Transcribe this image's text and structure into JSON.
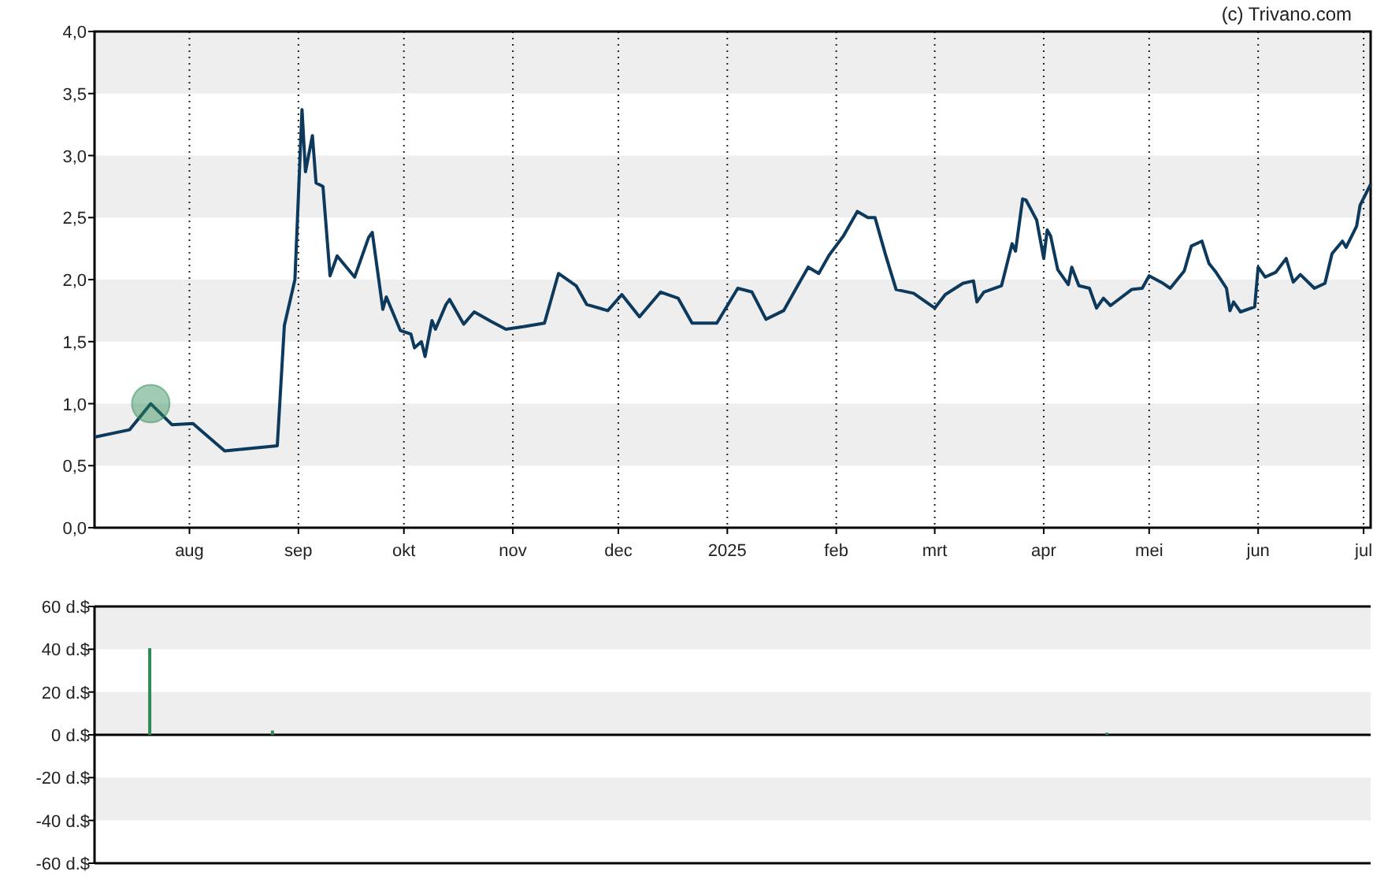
{
  "credit": "(c) Trivano.com",
  "price_chart": {
    "chart_data": {
      "type": "line",
      "xlim": [
        "2024-07-05",
        "2025-07-03"
      ],
      "ylim": [
        0,
        4
      ],
      "yticks": [
        {
          "value": 0,
          "label": "0,0"
        },
        {
          "value": 0.5,
          "label": "0,5"
        },
        {
          "value": 1,
          "label": "1,0"
        },
        {
          "value": 1.5,
          "label": "1,5"
        },
        {
          "value": 2,
          "label": "2,0"
        },
        {
          "value": 2.5,
          "label": "2,5"
        },
        {
          "value": 3,
          "label": "3,0"
        },
        {
          "value": 3.5,
          "label": "3,5"
        },
        {
          "value": 4,
          "label": "4,0"
        }
      ],
      "xticks": [
        {
          "value": "2024-08-01",
          "label": "aug"
        },
        {
          "value": "2024-09-01",
          "label": "sep"
        },
        {
          "value": "2024-10-01",
          "label": "okt"
        },
        {
          "value": "2024-11-01",
          "label": "nov"
        },
        {
          "value": "2024-12-01",
          "label": "dec"
        },
        {
          "value": "2025-01-01",
          "label": "2025"
        },
        {
          "value": "2025-02-01",
          "label": "feb"
        },
        {
          "value": "2025-03-01",
          "label": "mrt"
        },
        {
          "value": "2025-04-01",
          "label": "apr"
        },
        {
          "value": "2025-05-01",
          "label": "mei"
        },
        {
          "value": "2025-06-01",
          "label": "jun"
        },
        {
          "value": "2025-07-01",
          "label": "jul"
        }
      ],
      "x": [
        "2024-07-05",
        "2024-07-15",
        "2024-07-21",
        "2024-07-27",
        "2024-08-02",
        "2024-08-11",
        "2024-08-26",
        "2024-08-28",
        "2024-08-31",
        "2024-09-02",
        "2024-09-03",
        "2024-09-05",
        "2024-09-06",
        "2024-09-08",
        "2024-09-10",
        "2024-09-12",
        "2024-09-17",
        "2024-09-21",
        "2024-09-22",
        "2024-09-25",
        "2024-09-26",
        "2024-09-30",
        "2024-10-03",
        "2024-10-04",
        "2024-10-06",
        "2024-10-07",
        "2024-10-09",
        "2024-10-10",
        "2024-10-13",
        "2024-10-14",
        "2024-10-18",
        "2024-10-21",
        "2024-10-26",
        "2024-10-30",
        "2024-11-04",
        "2024-11-10",
        "2024-11-14",
        "2024-11-19",
        "2024-11-22",
        "2024-11-28",
        "2024-12-02",
        "2024-12-07",
        "2024-12-13",
        "2024-12-18",
        "2024-12-22",
        "2024-12-29",
        "2025-01-04",
        "2025-01-08",
        "2025-01-12",
        "2025-01-17",
        "2025-01-21",
        "2025-01-24",
        "2025-01-27",
        "2025-01-30",
        "2025-02-03",
        "2025-02-07",
        "2025-02-10",
        "2025-02-12",
        "2025-02-15",
        "2025-02-18",
        "2025-02-23",
        "2025-03-01",
        "2025-03-04",
        "2025-03-09",
        "2025-03-12",
        "2025-03-13",
        "2025-03-15",
        "2025-03-20",
        "2025-03-23",
        "2025-03-24",
        "2025-03-26",
        "2025-03-27",
        "2025-03-30",
        "2025-04-01",
        "2025-04-02",
        "2025-04-03",
        "2025-04-05",
        "2025-04-08",
        "2025-04-09",
        "2025-04-11",
        "2025-04-14",
        "2025-04-16",
        "2025-04-18",
        "2025-04-20",
        "2025-04-26",
        "2025-04-29",
        "2025-05-01",
        "2025-05-05",
        "2025-05-07",
        "2025-05-11",
        "2025-05-13",
        "2025-05-16",
        "2025-05-18",
        "2025-05-20",
        "2025-05-23",
        "2025-05-24",
        "2025-05-25",
        "2025-05-27",
        "2025-05-31",
        "2025-06-01",
        "2025-06-03",
        "2025-06-06",
        "2025-06-09",
        "2025-06-11",
        "2025-06-13",
        "2025-06-17",
        "2025-06-20",
        "2025-06-22",
        "2025-06-25",
        "2025-06-26",
        "2025-06-29",
        "2025-06-30",
        "2025-07-03"
      ],
      "series": [
        {
          "color": "#0d3a5c",
          "values": [
            0.73,
            0.79,
            1.0,
            0.83,
            0.84,
            0.62,
            0.66,
            1.63,
            2.0,
            3.37,
            2.87,
            3.16,
            2.78,
            2.75,
            2.03,
            2.19,
            2.02,
            2.34,
            2.38,
            1.76,
            1.86,
            1.59,
            1.56,
            1.45,
            1.5,
            1.38,
            1.67,
            1.6,
            1.8,
            1.84,
            1.64,
            1.74,
            1.66,
            1.6,
            1.62,
            1.65,
            2.05,
            1.95,
            1.8,
            1.75,
            1.88,
            1.7,
            1.9,
            1.85,
            1.65,
            1.65,
            1.93,
            1.9,
            1.68,
            1.75,
            1.95,
            2.1,
            2.05,
            2.2,
            2.35,
            2.55,
            2.5,
            2.5,
            2.2,
            1.92,
            1.89,
            1.77,
            1.88,
            1.97,
            1.99,
            1.82,
            1.9,
            1.95,
            2.29,
            2.23,
            2.65,
            2.64,
            2.48,
            2.17,
            2.4,
            2.35,
            2.08,
            1.96,
            2.1,
            1.95,
            1.93,
            1.77,
            1.85,
            1.79,
            1.92,
            1.93,
            2.03,
            1.97,
            1.93,
            2.07,
            2.27,
            2.31,
            2.13,
            2.06,
            1.93,
            1.75,
            1.82,
            1.74,
            1.78,
            2.1,
            2.02,
            2.06,
            2.17,
            1.98,
            2.04,
            1.93,
            1.97,
            2.21,
            2.31,
            2.26,
            2.43,
            2.6,
            2.77
          ]
        }
      ],
      "grid": true
    }
  },
  "volume_chart": {
    "chart_data": {
      "type": "bar",
      "ylim": [
        -60,
        60
      ],
      "yticks": [
        {
          "value": 60,
          "label": "60 d.$"
        },
        {
          "value": 40,
          "label": "40 d.$"
        },
        {
          "value": 20,
          "label": "20 d.$"
        },
        {
          "value": 0,
          "label": "0 d.$"
        },
        {
          "value": -20,
          "label": "-20 d.$"
        },
        {
          "value": -40,
          "label": "-40 d.$"
        },
        {
          "value": -60,
          "label": "-60 d.$"
        }
      ],
      "categories": [
        null,
        null,
        null,
        null,
        null,
        null,
        null,
        null,
        null,
        null,
        null,
        null,
        null,
        null,
        null,
        null,
        null,
        null,
        null,
        null,
        null,
        null,
        null,
        null,
        null,
        null,
        null,
        null,
        null,
        null,
        null,
        null,
        null,
        null,
        null,
        null,
        null,
        null,
        null,
        null,
        null,
        null,
        null,
        null,
        null,
        null,
        null,
        null,
        null,
        null,
        null,
        null,
        null,
        null,
        null,
        null,
        null,
        null,
        null,
        null,
        null,
        null,
        null,
        null,
        null,
        null,
        null,
        null,
        null,
        null,
        null,
        null,
        null,
        null,
        null,
        null,
        null,
        null,
        null,
        null,
        null,
        null,
        null,
        null,
        null,
        null,
        null,
        null,
        null,
        null,
        null,
        null,
        null,
        null,
        null,
        null,
        null,
        null,
        null,
        null,
        null,
        null,
        null,
        null
      ],
      "series": [
        {
          "color": "#2e8b57",
          "values": [
            null,
            null,
            null,
            null,
            40.5,
            null,
            null,
            null,
            null,
            null,
            null,
            null,
            null,
            null,
            2,
            null,
            null,
            null,
            null,
            null,
            null,
            null,
            null,
            null,
            null,
            null,
            null,
            null,
            null,
            null,
            null,
            null,
            null,
            null,
            null,
            null,
            null,
            null,
            null,
            null,
            null,
            null,
            null,
            null,
            null,
            null,
            null,
            null,
            null,
            null,
            null,
            null,
            null,
            null,
            null,
            null,
            null,
            null,
            null,
            null,
            null,
            null,
            null,
            null,
            null,
            null,
            null,
            null,
            null,
            null,
            null,
            null,
            null,
            null,
            null,
            null,
            null,
            null,
            null,
            null,
            null,
            null,
            1,
            null,
            null,
            null,
            null,
            null,
            null,
            null,
            null,
            null,
            null,
            null,
            null,
            null,
            null,
            null,
            null,
            null,
            null,
            null,
            null,
            null
          ]
        }
      ]
    }
  }
}
